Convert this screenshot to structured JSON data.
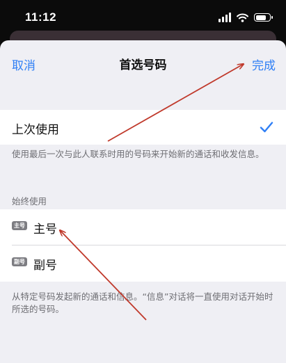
{
  "status_bar": {
    "time": "11:12"
  },
  "nav": {
    "cancel_label": "取消",
    "title": "首选号码",
    "done_label": "完成"
  },
  "last_used": {
    "label": "上次使用",
    "selected": true,
    "footer": "使用最后一次与此人联系时用的号码来开始新的通话和收发信息。"
  },
  "always_use": {
    "header": "始终使用",
    "options": [
      {
        "badge": "主号",
        "label": "主号"
      },
      {
        "badge": "副号",
        "label": "副号"
      }
    ],
    "footer": "从特定号码发起新的通话和信息。“信息”对话将一直使用对话开始时所选的号码。"
  },
  "colors": {
    "accent": "#2f7ff5",
    "annotation_arrow": "#c0392b",
    "sheet_background": "#efeff4"
  },
  "icons": [
    "signal-icon",
    "wifi-icon",
    "battery-icon",
    "checkmark-icon"
  ]
}
